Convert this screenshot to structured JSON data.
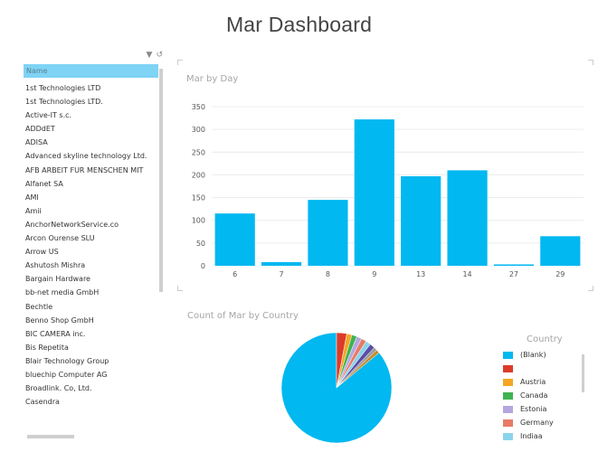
{
  "dashboard": {
    "title": "Mar Dashboard"
  },
  "slicer": {
    "header": "Name",
    "items": [
      "1st Technologies LTD",
      "1st Technologies LTD.",
      "Active-IT s.c.",
      "ADDdET",
      "ADISA",
      "Advanced skyline technology Ltd.",
      "AFB ARBEIT FUR MENSCHEN MIT",
      "Alfanet SA",
      "AMI",
      "Amii",
      "AnchorNetworkService.co",
      "Arcon Ourense SLU",
      "Arrow US",
      "Ashutosh Mishra",
      "Bargain Hardware",
      "bb-net media GmbH",
      "Bechtle",
      "Benno Shop GmbH",
      "BIC CAMERA inc.",
      "Bis Repetita",
      "Blair Technology Group",
      "bluechip Computer AG",
      "Broadlink. Co, Ltd.",
      "Casendra"
    ]
  },
  "chart_data": [
    {
      "type": "bar",
      "title": "Mar by Day",
      "categories": [
        "6",
        "7",
        "8",
        "9",
        "13",
        "14",
        "27",
        "29"
      ],
      "values": [
        115,
        8,
        145,
        322,
        197,
        210,
        3,
        65
      ],
      "ylim": [
        0,
        350
      ],
      "yticks": [
        0,
        50,
        100,
        150,
        200,
        250,
        300,
        350
      ],
      "color": "#01b8f0",
      "grid": true
    },
    {
      "type": "pie",
      "title": "Count of Mar by Country",
      "legend_title": "Country",
      "legend_position": "right",
      "slices": [
        {
          "label": "(Blank)",
          "value": 86.0,
          "color": "#01b8f0"
        },
        {
          "label": "",
          "value": 3.0,
          "color": "#dd3b2a"
        },
        {
          "label": "Austria",
          "value": 1.5,
          "color": "#f5a623"
        },
        {
          "label": "Canada",
          "value": 1.5,
          "color": "#3fb34f"
        },
        {
          "label": "Estonia",
          "value": 1.5,
          "color": "#b5a6e0"
        },
        {
          "label": "Germany",
          "value": 1.5,
          "color": "#e87b65"
        },
        {
          "label": "India",
          "value": 1.5,
          "color": "#8ad4eb"
        },
        {
          "label": "",
          "value": 1.5,
          "color": "#5b4ea8"
        },
        {
          "label": "",
          "value": 1.0,
          "color": "#9c9c9c"
        },
        {
          "label": "",
          "value": 1.0,
          "color": "#c48a2c"
        }
      ],
      "legend_visible": [
        "(Blank)",
        "",
        "Austria",
        "Canada",
        "Estonia",
        "Germany",
        "Indiaa"
      ]
    }
  ]
}
